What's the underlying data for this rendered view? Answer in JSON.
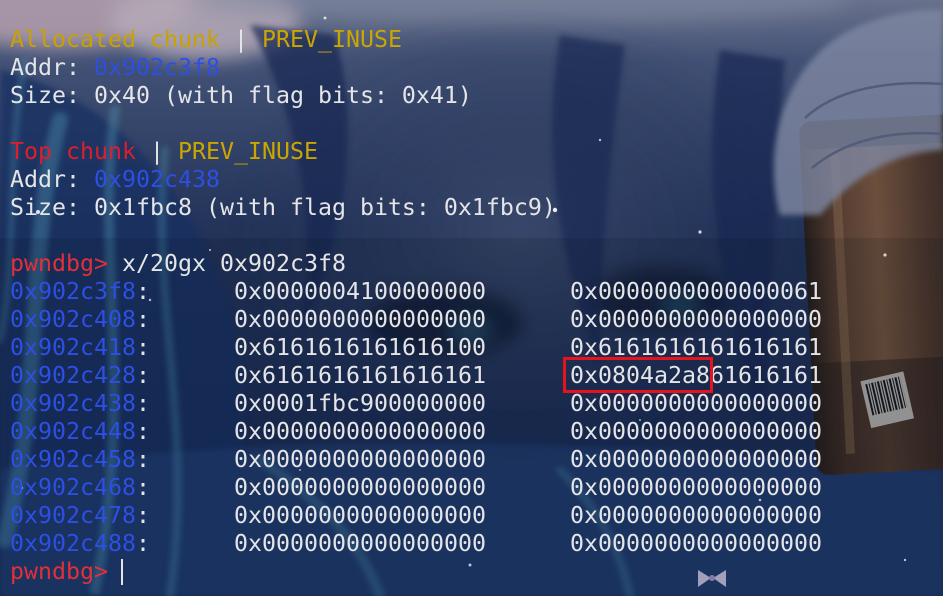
{
  "theme": {
    "text": "#e5e5e7",
    "chunk_allocated": "#c8a200",
    "chunk_top": "#dc1f2b",
    "flag": "#cca600",
    "address": "#2d4fe3",
    "prompt": "#e2303b",
    "highlight_box": "#e4131d"
  },
  "chunks": [
    {
      "type_label": "Allocated chunk",
      "separator": "|",
      "flag": "PREV_INUSE",
      "addr_label": "Addr:",
      "addr": "0x902c3f8",
      "size_line": "Size: 0x40 (with flag bits: 0x41)"
    },
    {
      "type_label": "Top chunk",
      "separator": "|",
      "flag": "PREV_INUSE",
      "addr_label": "Addr:",
      "addr": "0x902c438",
      "size_line": "Size: 0x1fbc8 (with flag bits: 0x1fbc9)"
    }
  ],
  "command": {
    "prompt": "pwndbg>",
    "text": "x/20gx 0x902c3f8"
  },
  "memory_dump": {
    "addr_suffix": ":",
    "rows": [
      {
        "address": "0x902c3f8",
        "col1": "0x0000004100000000",
        "col2": "0x0000000000000061"
      },
      {
        "address": "0x902c408",
        "col1": "0x0000000000000000",
        "col2": "0x0000000000000000"
      },
      {
        "address": "0x902c418",
        "col1": "0x6161616161616100",
        "col2": "0x6161616161616161"
      },
      {
        "address": "0x902c428",
        "col1": "0x6161616161616161",
        "col2": "0x0804a2a861616161"
      },
      {
        "address": "0x902c438",
        "col1": "0x0001fbc900000000",
        "col2": "0x0000000000000000"
      },
      {
        "address": "0x902c448",
        "col1": "0x0000000000000000",
        "col2": "0x0000000000000000"
      },
      {
        "address": "0x902c458",
        "col1": "0x0000000000000000",
        "col2": "0x0000000000000000"
      },
      {
        "address": "0x902c468",
        "col1": "0x0000000000000000",
        "col2": "0x0000000000000000"
      },
      {
        "address": "0x902c478",
        "col1": "0x0000000000000000",
        "col2": "0x0000000000000000"
      },
      {
        "address": "0x902c488",
        "col1": "0x0000000000000000",
        "col2": "0x0000000000000000"
      }
    ]
  },
  "final_prompt": {
    "prompt": "pwndbg>"
  }
}
